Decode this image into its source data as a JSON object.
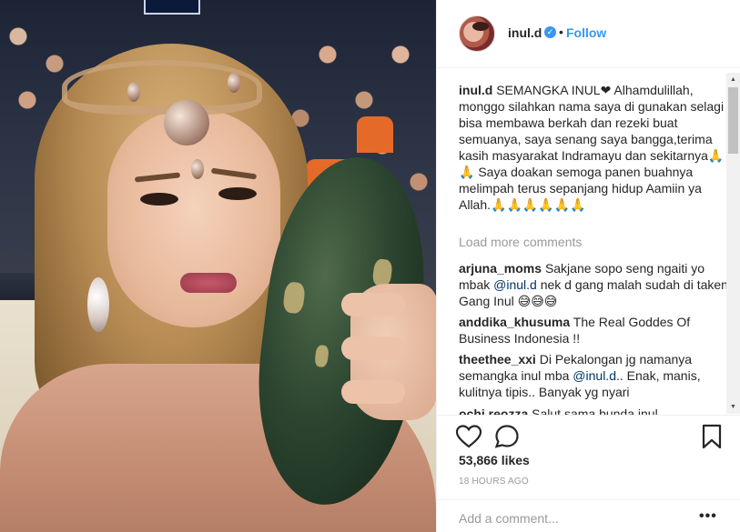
{
  "post": {
    "header": {
      "username": "inul.d",
      "verified_icon": "verified-badge-icon",
      "separator": "•",
      "follow_label": "Follow"
    },
    "caption": {
      "username": "inul.d",
      "text": "SEMANGKA INUL❤ Alhamdulillah, monggo silahkan nama saya di gunakan selagi bisa membawa berkah dan rezeki buat semuanya, saya senang saya bangga,terima kasih masyarakat Indramayu dan sekitarnya🙏🙏 Saya doakan semoga panen buahnya melimpah terus sepanjang hidup Aamiin ya Allah.🙏🙏🙏🙏🙏🙏"
    },
    "load_more_label": "Load more comments",
    "comments": [
      {
        "username": "arjuna_moms",
        "text_before": "Sakjane sopo seng ngaiti yo mbak ",
        "mention": "@inul.d",
        "text_after": " nek d gang malah sudah di taken Gang Inul 😅😅😅"
      },
      {
        "username": "anddika_khusuma",
        "text_before": "The Real Goddes Of Business Indonesia !!",
        "mention": "",
        "text_after": ""
      },
      {
        "username": "theethee_xxi",
        "text_before": "Di Pekalongan jg namanya semangka inul mba ",
        "mention": "@inul.d",
        "text_after": ".. Enak, manis, kulitnya tipis.. Banyak yg nyari"
      },
      {
        "username": "ochi.reozza",
        "text_before": "Salut sama bunda inul",
        "mention": "",
        "text_after": ""
      }
    ],
    "likes": "53,866 likes",
    "timestamp": "18 HOURS AGO",
    "add_comment_placeholder": "Add a comment...",
    "more_options": "•••",
    "icons": {
      "like": "heart-icon",
      "comment": "comment-bubble-icon",
      "save": "bookmark-icon"
    },
    "colors": {
      "link_blue": "#3897f0",
      "text": "#262626",
      "muted": "#999999",
      "border": "#efefef"
    }
  }
}
